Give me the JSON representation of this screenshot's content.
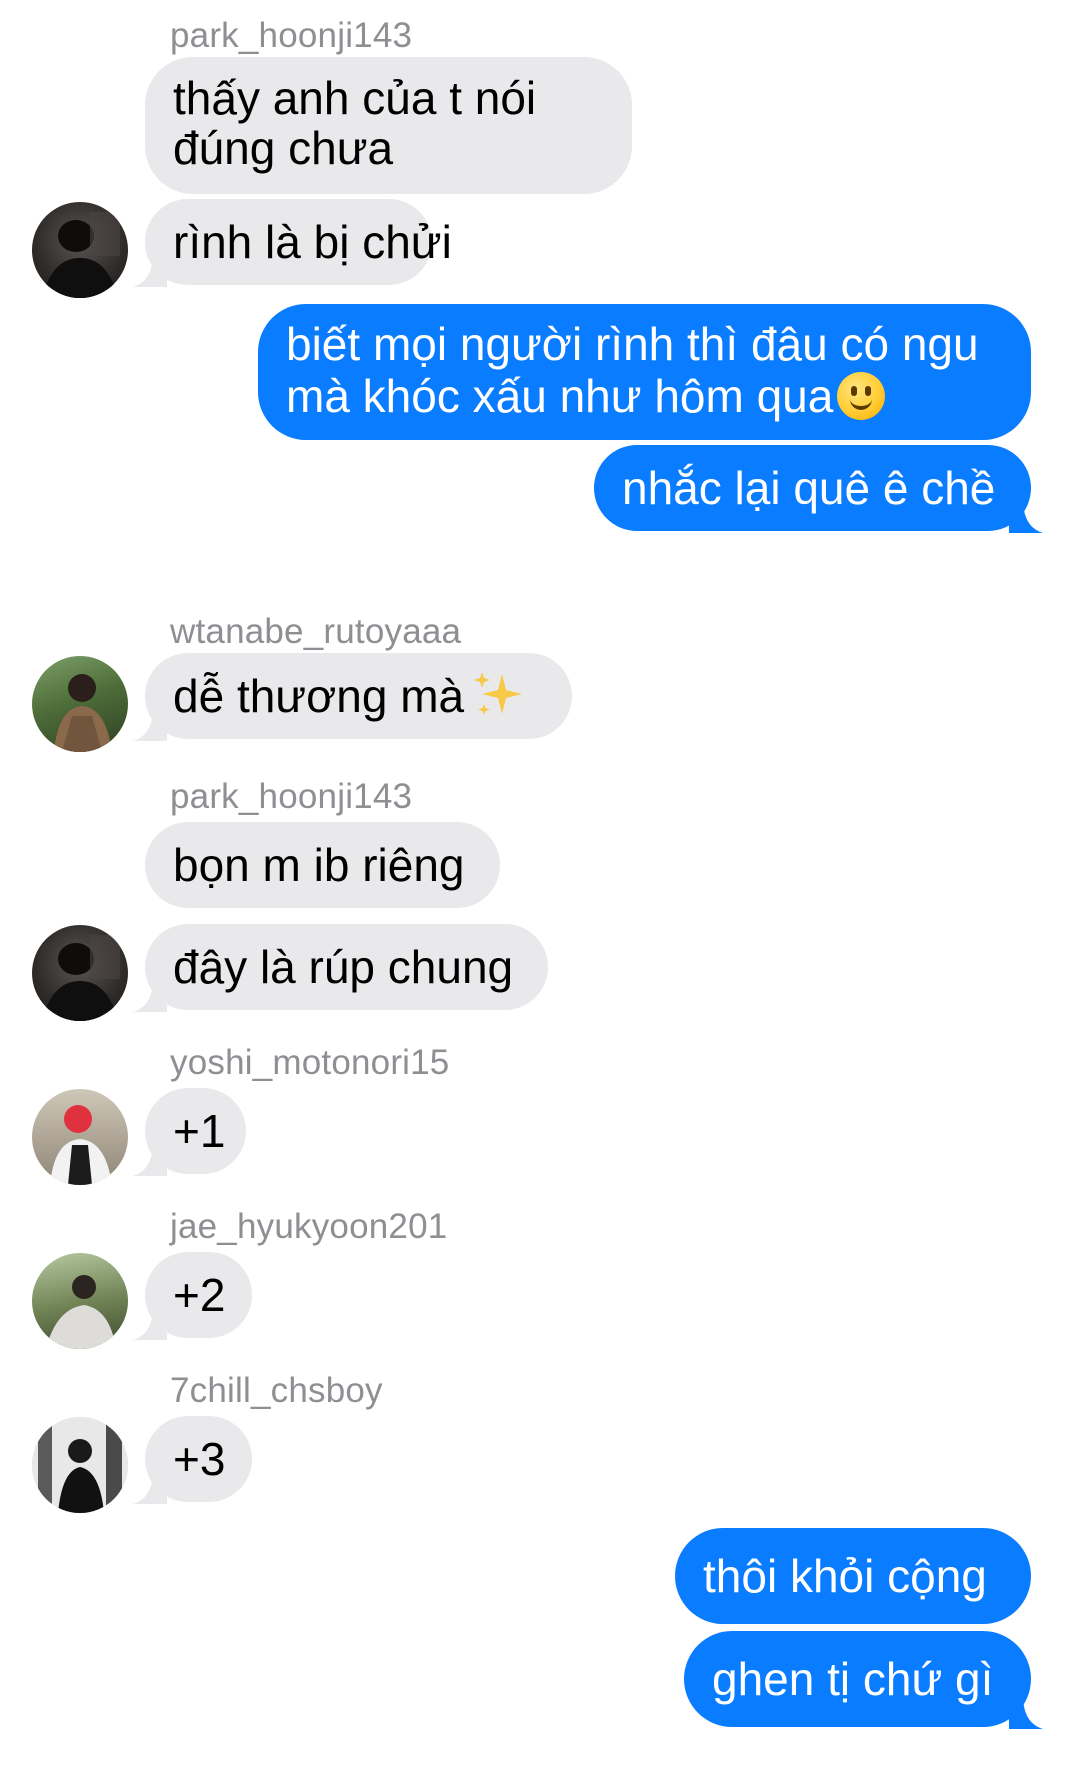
{
  "colors": {
    "incoming_bubble": "#e9e9eb",
    "outgoing_bubble": "#0a7cff",
    "sender_name": "#8e8e93"
  },
  "messages": [
    {
      "sender": "park_hoonji143",
      "text": "thấy anh của t nói đúng chưa"
    },
    {
      "text": "rình là bị chửi"
    },
    {
      "outgoing": true,
      "text": "biết mọi người rình thì đâu có ngu mà khóc xấu như hôm qua",
      "emoji": "slightly-smiling-face"
    },
    {
      "outgoing": true,
      "text": "nhắc lại quê ê chề"
    },
    {
      "sender": "wtanabe_rutoyaaa",
      "text": "dễ thương mà",
      "emoji": "sparkles"
    },
    {
      "sender": "park_hoonji143",
      "text": "bọn m ib riêng"
    },
    {
      "text": "đây là rúp chung"
    },
    {
      "sender": "yoshi_motonori15",
      "text": "+1"
    },
    {
      "sender": "jae_hyukyoon201",
      "text": "+2"
    },
    {
      "sender": "7chill_chsboy",
      "text": "+3"
    },
    {
      "outgoing": true,
      "text": "thôi khỏi cộng"
    },
    {
      "outgoing": true,
      "text": "ghen tị chứ gì"
    }
  ]
}
